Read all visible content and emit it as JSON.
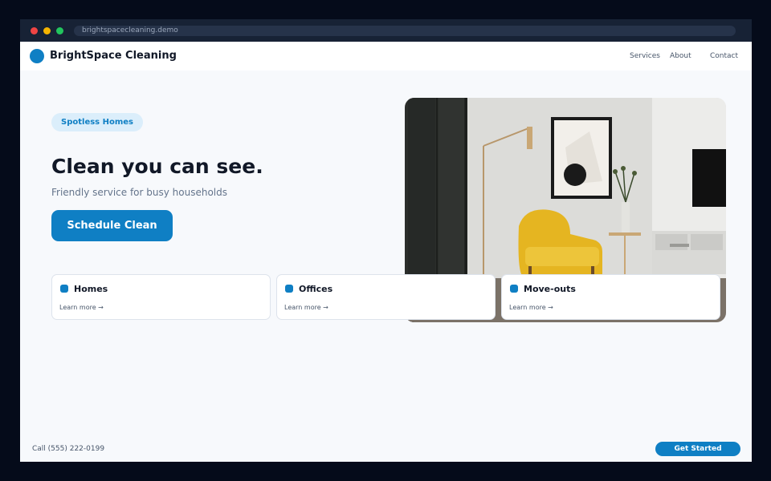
{
  "browser": {
    "url": "brightspacecleaning.demo"
  },
  "header": {
    "brand": "BrightSpace Cleaning",
    "nav": [
      "Services",
      "About",
      "Contact"
    ]
  },
  "hero": {
    "badge": "Spotless Homes",
    "title": "Clean you can see.",
    "subtitle": "Friendly service for busy households",
    "cta_label": "Schedule Clean",
    "image_description": "living-room-photo"
  },
  "cards": [
    {
      "title": "Homes",
      "link": "Learn more →"
    },
    {
      "title": "Offices",
      "link": "Learn more →"
    },
    {
      "title": "Move-outs",
      "link": "Learn more →"
    }
  ],
  "footer": {
    "phone": "Call (555) 222-0199",
    "cta_label": "Get Started"
  },
  "colors": {
    "accent": "#0f7fc4",
    "page_background": "#f7f9fc",
    "outer_background": "#050b1a",
    "chip_background": "#dbeefb"
  }
}
